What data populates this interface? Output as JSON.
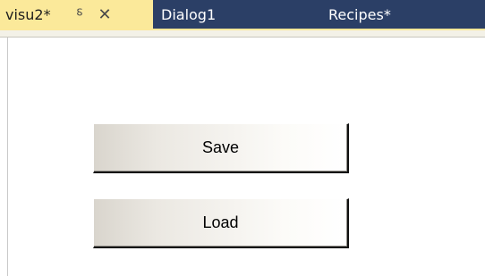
{
  "tabs": {
    "active": {
      "label": "visu2*",
      "pin_icon": "pin-icon",
      "pin_glyph": "⸹",
      "close_icon": "close-icon",
      "close_glyph": "✕"
    },
    "items": [
      {
        "label": "Dialog1"
      },
      {
        "label": "Recipes*"
      }
    ]
  },
  "buttons": {
    "save_label": "Save",
    "load_label": "Load"
  },
  "colors": {
    "tabbar_bg": "#2b3f66",
    "active_tab_bg": "#fbe99a",
    "tab_text": "#ffffff"
  }
}
